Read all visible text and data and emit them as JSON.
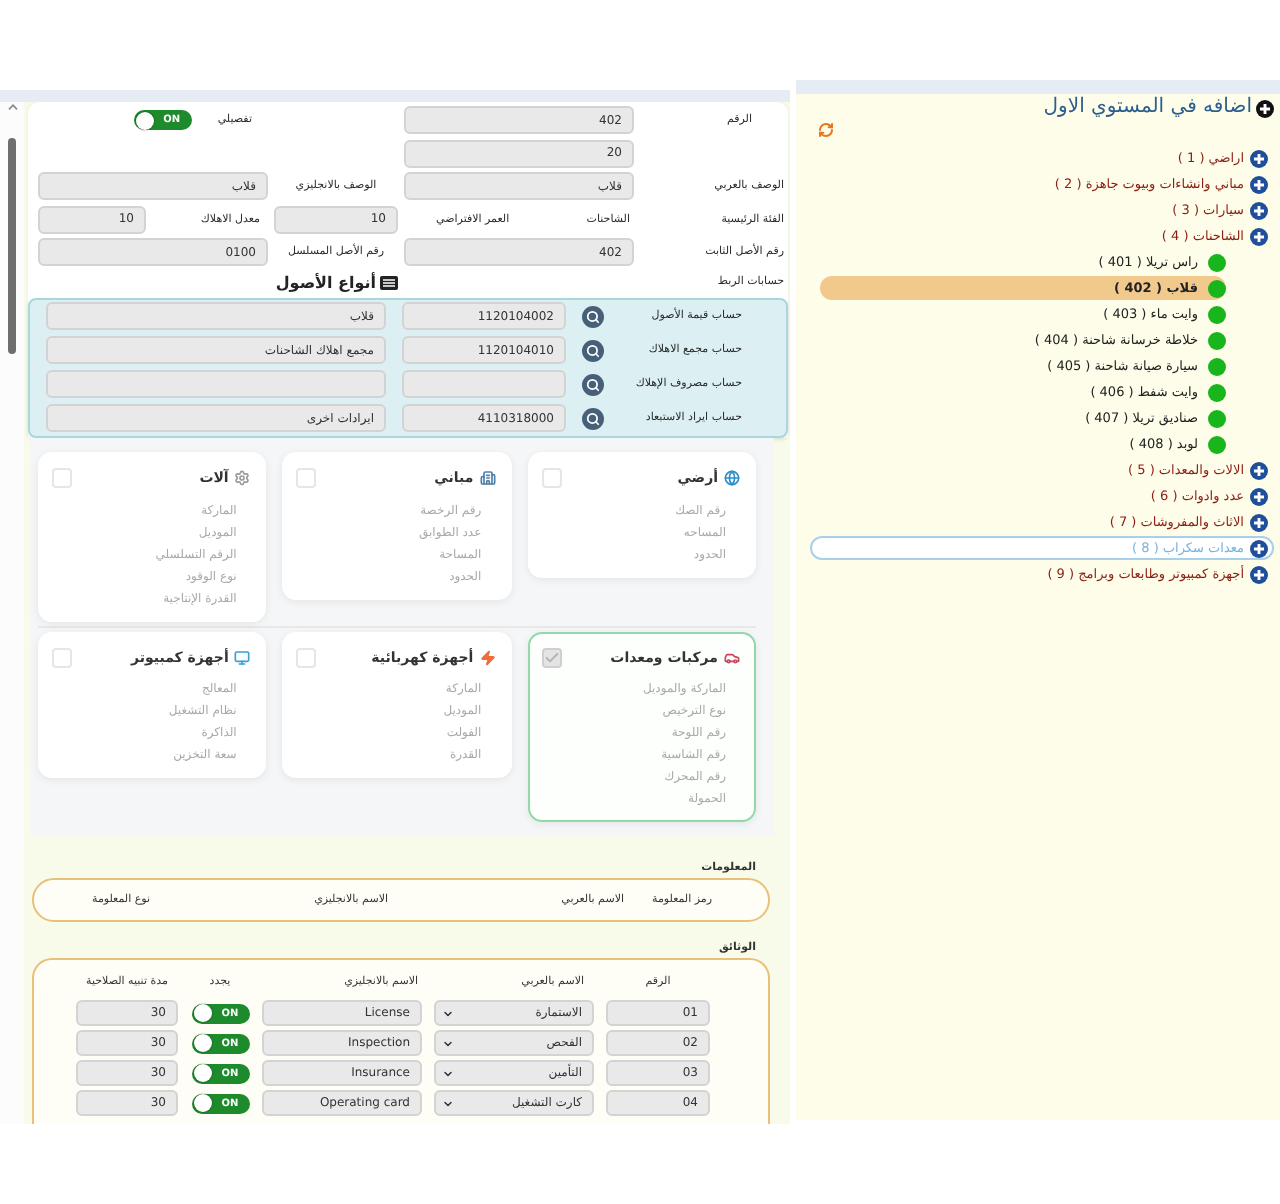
{
  "tree_panel": {
    "title": "اضافه في المستوي الاول",
    "items": [
      {
        "label": "اراضي ( 1 )",
        "selected": false
      },
      {
        "label": "مباني وانشاءات وبيوت جاهزة ( 2 )",
        "selected": false
      },
      {
        "label": "سيارات ( 3 )",
        "selected": false
      },
      {
        "label": "الشاحنات ( 4 )",
        "selected": false,
        "children": [
          {
            "label": "راس تريلا ( 401 )",
            "selected": false
          },
          {
            "label": "قلاب ( 402 )",
            "selected": true
          },
          {
            "label": "وايت ماء ( 403 )",
            "selected": false
          },
          {
            "label": "خلاطة خرسانة شاحنة ( 404 )",
            "selected": false
          },
          {
            "label": "سيارة صيانة شاحنة ( 405 )",
            "selected": false
          },
          {
            "label": "وايت شفط ( 406 )",
            "selected": false
          },
          {
            "label": "صناديق تريلا ( 407 )",
            "selected": false
          },
          {
            "label": "لوبد ( 408 )",
            "selected": false
          }
        ]
      },
      {
        "label": "الالات والمعدات ( 5 )",
        "selected": false
      },
      {
        "label": "عدد وادوات ( 6 )",
        "selected": false
      },
      {
        "label": "الاثاث والمفروشات ( 7 )",
        "selected": false
      },
      {
        "label": "معدات سكراب ( 8 )",
        "selected": true
      },
      {
        "label": "أجهزة كمبيوتر وطابعات وبرامج ( 9 )",
        "selected": false
      }
    ]
  },
  "form": {
    "number": {
      "label": "الرقم",
      "value": "402"
    },
    "sub_value": {
      "value": "20"
    },
    "detailed": {
      "label": "تفصيلي",
      "switch_text": "ON",
      "on": true
    },
    "name_ar": {
      "label": "الوصف بالعربي",
      "value": "قلاب"
    },
    "name_en": {
      "label": "الوصف بالانجليزي",
      "value": "قلاب"
    },
    "main_category": {
      "label": "الفئة الرئيسية",
      "value": "الشاحنات"
    },
    "useful_life": {
      "label": "العمر الافتراضي",
      "value": "10"
    },
    "depreciation_rate": {
      "label": "معدل الاهلاك",
      "value": "10"
    },
    "fixed_asset_number": {
      "label": "رقم الأصل الثابت",
      "value": "402"
    },
    "serial_asset_number": {
      "label": "رقم الأصل المسلسل",
      "value": "0100"
    },
    "linked_accounts": {
      "label": "حسابات الربط",
      "rows": [
        {
          "label": "حساب قيمة الأصول",
          "account": "1120104002",
          "account_name": "قلاب"
        },
        {
          "label": "حساب مجمع الاهلاك",
          "account": "1120104010",
          "account_name": "مجمع اهلاك الشاحنات"
        },
        {
          "label": "حساب مصروف الإهلاك"
        },
        {
          "label": "حساب ايراد الاستبعاد",
          "account": "4110318000",
          "account_name": "ايرادات اخرى"
        }
      ]
    }
  },
  "asset_types": {
    "title": "أنواع الأصول",
    "cards": [
      {
        "kind": "land",
        "title": "أرضي",
        "checked": false,
        "fields": [
          "رقم الصك",
          "المساحه",
          "الحدود"
        ]
      },
      {
        "kind": "building",
        "title": "مباني",
        "checked": false,
        "fields": [
          "رقم الرخصة",
          "عدد الطوابق",
          "المساحة",
          "الحدود"
        ]
      },
      {
        "kind": "machine",
        "title": "آلات",
        "checked": false,
        "fields": [
          "الماركة",
          "الموديل",
          "الرقم التسلسلي",
          "نوع الوقود",
          "القدرة الإنتاجية"
        ]
      },
      {
        "kind": "vehicle",
        "title": "مركبات ومعدات",
        "checked": true,
        "fields": [
          "الماركة والموديل",
          "نوع الترخيص",
          "رقم اللوحة",
          "رقم الشاسية",
          "رقم المحرك",
          "الحمولة"
        ]
      },
      {
        "kind": "electrical",
        "title": "أجهزة كهربائية",
        "checked": false,
        "fields": [
          "الماركة",
          "الموديل",
          "الفولت",
          "القدرة"
        ]
      },
      {
        "kind": "computer",
        "title": "أجهزة كمبيوتر",
        "checked": false,
        "fields": [
          "المعالج",
          "نظام التشغيل",
          "الذاكرة",
          "سعة التخزين"
        ]
      }
    ]
  },
  "info_section": {
    "label": "المعلومات",
    "columns": [
      "رمز المعلومة",
      "الاسم بالعربي",
      "الاسم بالانجليزي",
      "نوع المعلومة"
    ]
  },
  "documents": {
    "label": "الوثائق",
    "columns": [
      "الرقم",
      "الاسم بالعربي",
      "الاسم بالانجليزي",
      "يجدد",
      "مدة تنبيه الصلاحية"
    ],
    "rows": [
      {
        "number": "01",
        "name_ar": "الاستمارة",
        "name_en": "License",
        "renew": {
          "text": "ON",
          "on": true
        },
        "alert_days": "30"
      },
      {
        "number": "02",
        "name_ar": "الفحص",
        "name_en": "Inspection",
        "renew": {
          "text": "ON",
          "on": true
        },
        "alert_days": "30"
      },
      {
        "number": "03",
        "name_ar": "التأمين",
        "name_en": "Insurance",
        "renew": {
          "text": "ON",
          "on": true
        },
        "alert_days": "30"
      },
      {
        "number": "04",
        "name_ar": "كارت التشغيل",
        "name_en": "Operating card",
        "renew": {
          "text": "ON",
          "on": true
        },
        "alert_days": "30"
      }
    ]
  }
}
